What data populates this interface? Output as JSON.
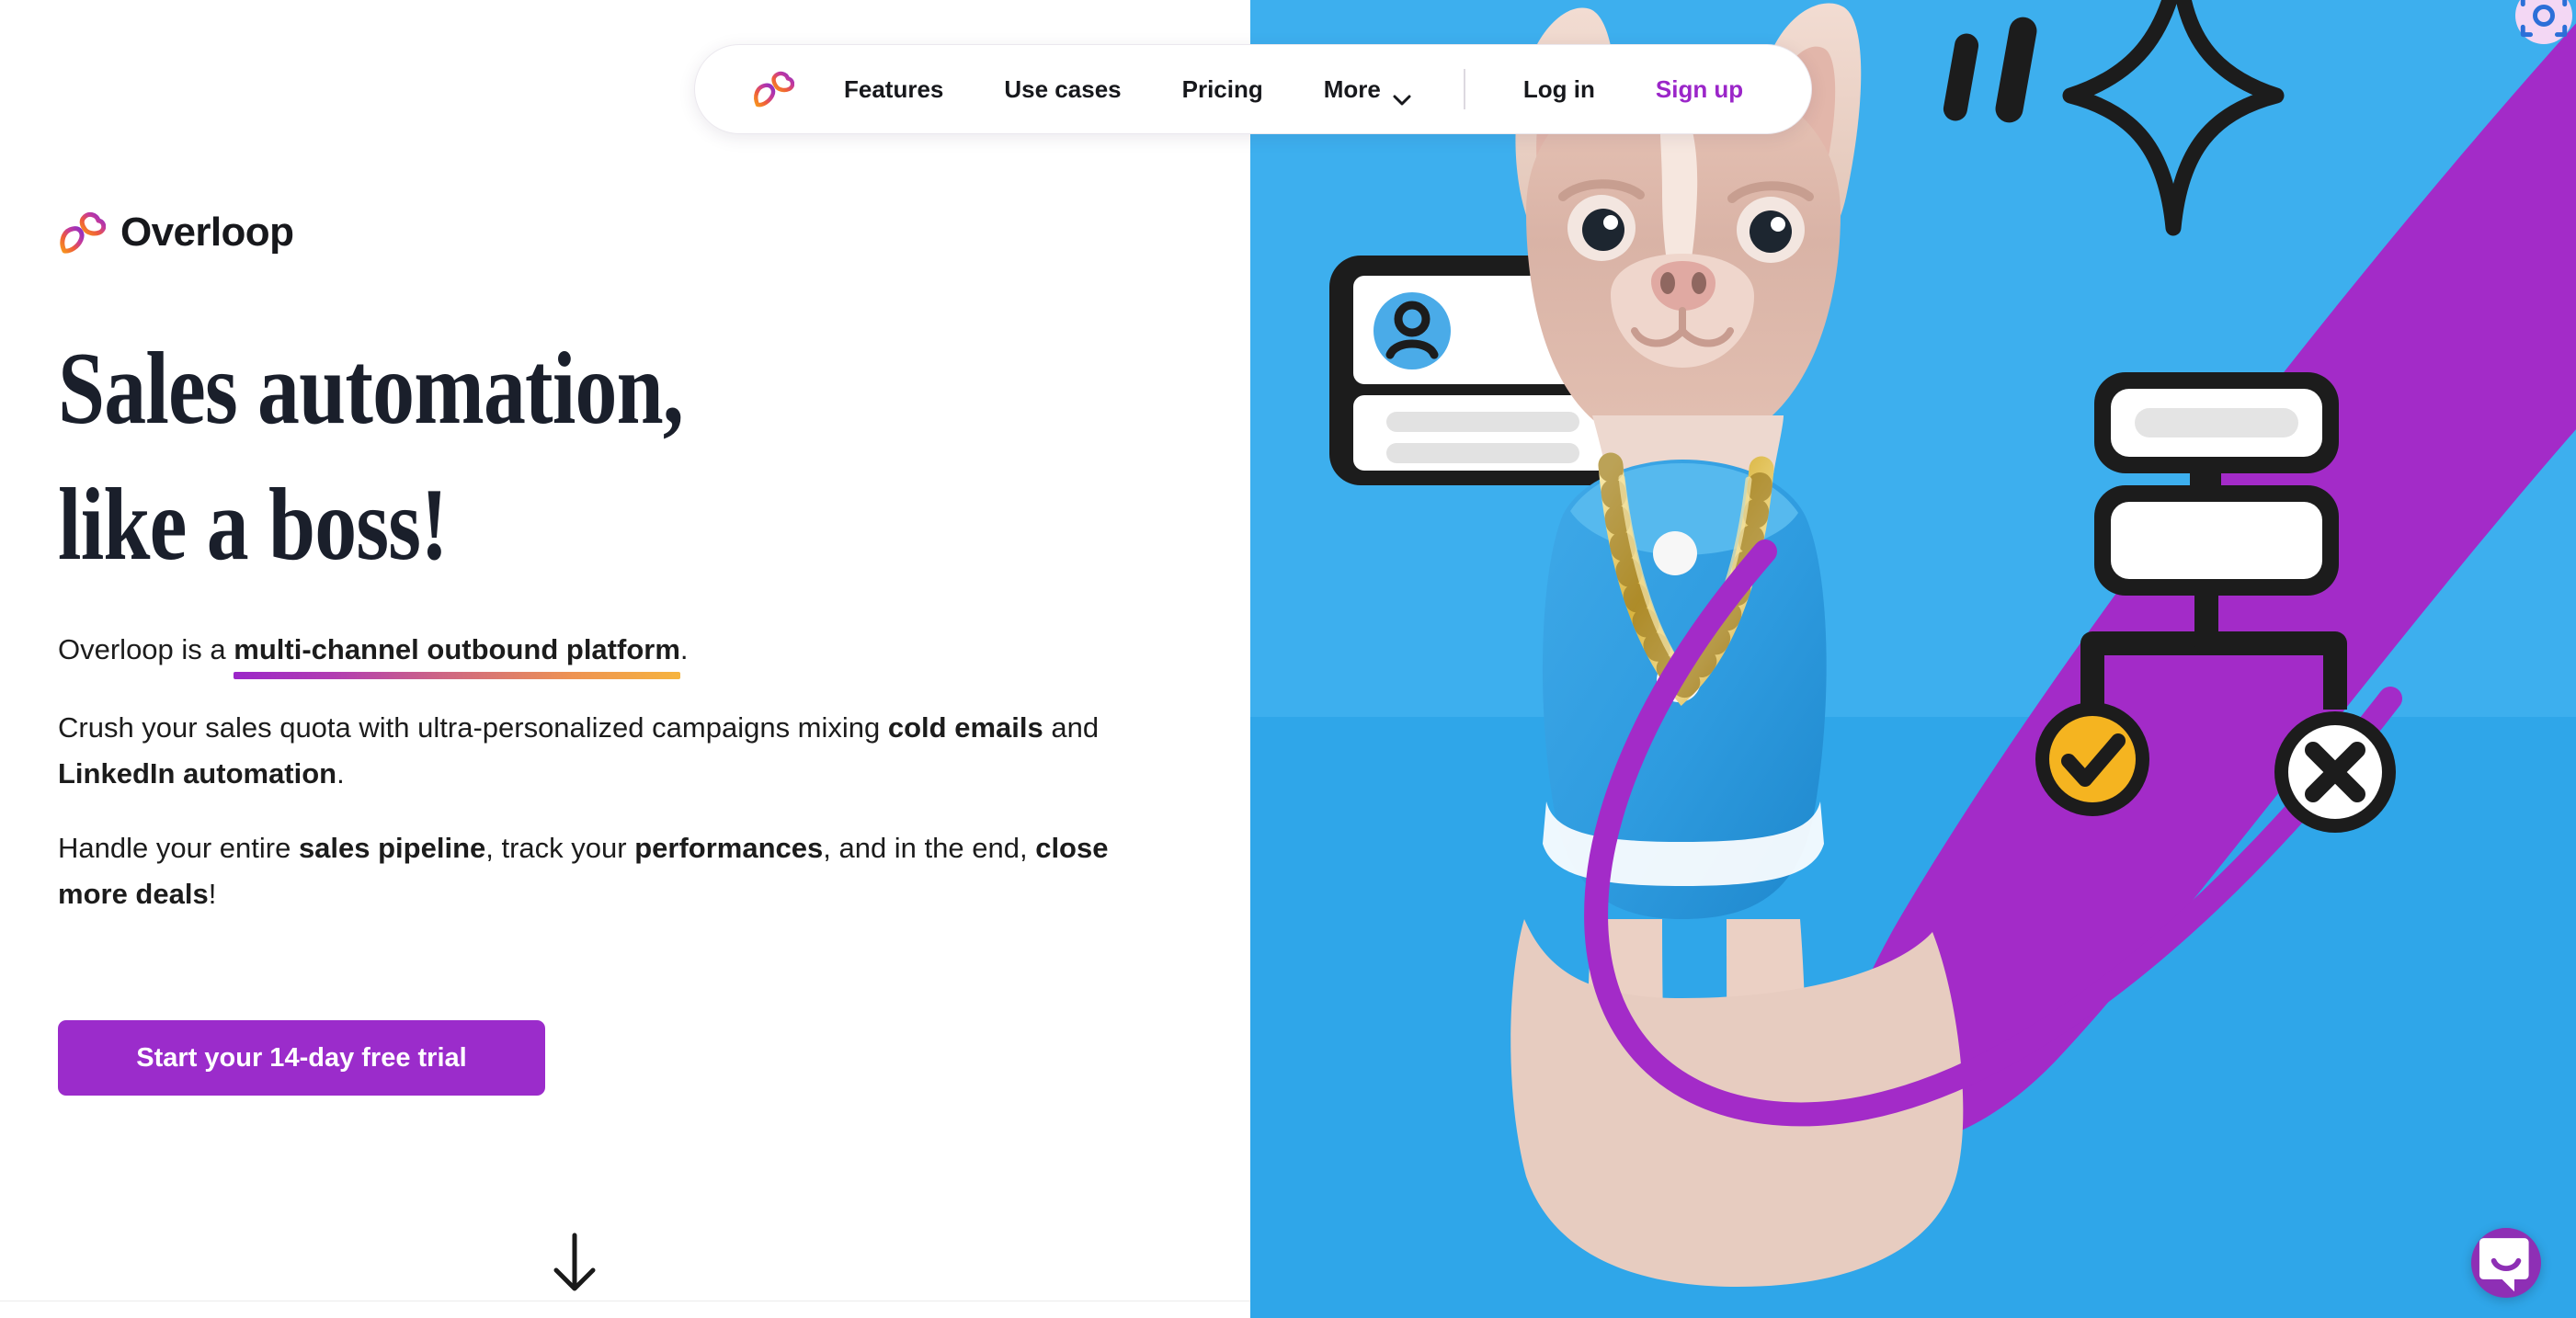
{
  "nav": {
    "logo_icon": "overloop-gradient-mark",
    "links": [
      {
        "label": "Features"
      },
      {
        "label": "Use cases"
      },
      {
        "label": "Pricing"
      }
    ],
    "more": {
      "label": "More",
      "icon": "chevron-down-icon"
    },
    "login_label": "Log in",
    "signup_label": "Sign up",
    "signup_color": "#9B26C9"
  },
  "brand": {
    "name": "Overloop",
    "mark_icon": "overloop-gradient-mark"
  },
  "hero": {
    "headline_line1": "Sales automation,",
    "headline_line2": "like a boss!",
    "lead_before": "Overloop is a ",
    "lead_highlight": "multi-channel outbound platform",
    "lead_after": ".",
    "para2_a": "Crush your sales quota with ultra-personalized campaigns mixing ",
    "para2_b": "cold emails",
    "para2_c": " and ",
    "para2_d": "LinkedIn automation",
    "para2_e": ".",
    "para3_a": "Handle your entire ",
    "para3_b": "sales pipeline",
    "para3_c": ", track your ",
    "para3_d": "performances",
    "para3_e": ", and in the end, ",
    "para3_f": "close more deals",
    "para3_g": "!",
    "cta_label": "Start your 14-day free trial",
    "cta_color": "#9B2CCB",
    "scroll_icon": "arrow-down-icon"
  },
  "artwork": {
    "background_color": "#3DAFEE",
    "swoosh_color": "#A32BC8",
    "subject": "french-bulldog-photo",
    "star_icon": "sparkle-star-icon",
    "contact_card_icon": "contact-card-illustration",
    "workflow_icon": "workflow-diagram-illustration",
    "check_badge_color": "#F5B420",
    "check_icon": "check-circle-icon",
    "cross_icon": "x-circle-icon",
    "corner_badge_icon": "scan-camera-icon"
  },
  "chat": {
    "launcher_icon": "chat-bubble-smile-icon",
    "launcher_color": "#8E2FB5"
  }
}
